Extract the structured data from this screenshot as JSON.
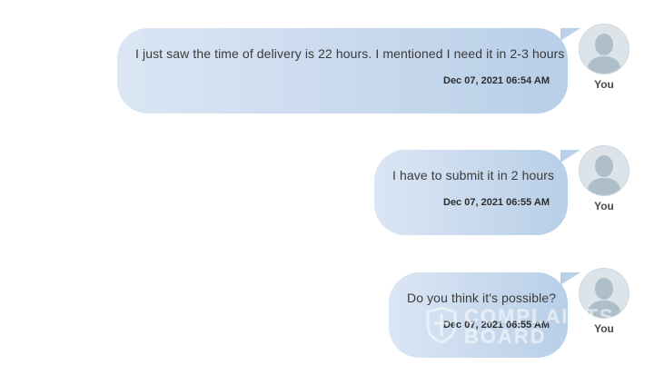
{
  "messages": [
    {
      "text": "I just saw the time of delivery is 22 hours. I mentioned I need it in 2-3 hours",
      "timestamp": "Dec 07, 2021 06:54 AM",
      "sender": "You"
    },
    {
      "text": "I have to submit it in 2 hours",
      "timestamp": "Dec 07, 2021 06:55 AM",
      "sender": "You"
    },
    {
      "text": "Do you think it's possible?",
      "timestamp": "Dec 07, 2021 06:55 AM",
      "sender": "You"
    }
  ],
  "watermark": {
    "line1": "COMPLAINTS",
    "line2": "BOARD"
  },
  "colors": {
    "bubble_start": "#dbe6f4",
    "bubble_end": "#b8cfe8",
    "avatar_bg": "#dce3e9",
    "avatar_figure": "#aebfca"
  },
  "icons": {
    "avatar": "user-silhouette-icon",
    "watermark": "shield-logo-icon"
  }
}
